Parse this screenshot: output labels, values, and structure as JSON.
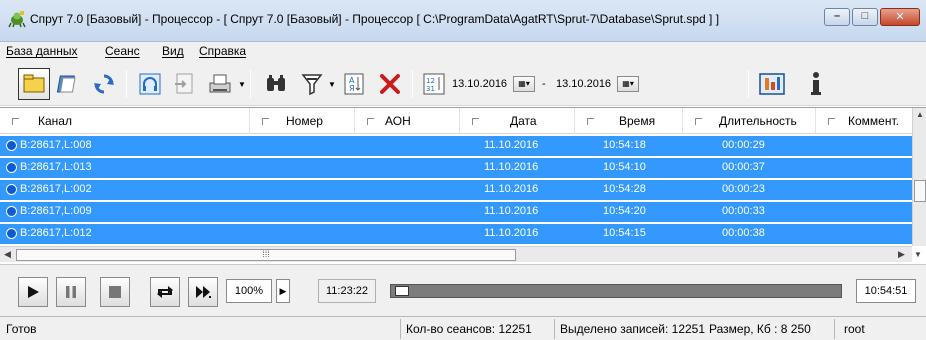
{
  "window": {
    "title": "Спрут 7.0 [Базовый] - Процессор - [ Спрут 7.0 [Базовый] - Процессор [ C:\\ProgramData\\AgatRT\\Sprut-7\\Database\\Sprut.spd ] ]",
    "icon": "app-icon",
    "buttons": [
      "minimize-icon",
      "maximize-icon",
      "close-icon"
    ]
  },
  "menu": [
    "База данных",
    "Сеанс",
    "Вид",
    "Справка"
  ],
  "toolbar": {
    "date_from": "13.10.2016",
    "date_sep": "-",
    "date_to": "13.10.2016"
  },
  "table": {
    "columns": [
      "Канал",
      "Номер",
      "АОН",
      "Дата",
      "Время",
      "Длительность",
      "Коммент."
    ],
    "rows": [
      {
        "channel": "B:28617,L:008",
        "number": "",
        "aon": "",
        "date": "11.10.2016",
        "time": "10:54:18",
        "duration": "00:00:29"
      },
      {
        "channel": "B:28617,L:013",
        "number": "",
        "aon": "",
        "date": "11.10.2016",
        "time": "10:54:10",
        "duration": "00:00:37"
      },
      {
        "channel": "B:28617,L:002",
        "number": "",
        "aon": "",
        "date": "11.10.2016",
        "time": "10:54:28",
        "duration": "00:00:23"
      },
      {
        "channel": "B:28617,L:009",
        "number": "",
        "aon": "",
        "date": "11.10.2016",
        "time": "10:54:20",
        "duration": "00:00:33"
      },
      {
        "channel": "B:28617,L:012",
        "number": "",
        "aon": "",
        "date": "11.10.2016",
        "time": "10:54:15",
        "duration": "00:00:38"
      }
    ],
    "selection_color": "#3399ff"
  },
  "player": {
    "volume": "100%",
    "current_time": "11:23:22",
    "end_time": "10:54:51",
    "position": 0.01
  },
  "status": {
    "state": "Готов",
    "sessions": "Кол-во сеансов: 12251",
    "selected": "Выделено записей: 12251",
    "size": "Размер, Кб : 8 250",
    "user": "root"
  }
}
